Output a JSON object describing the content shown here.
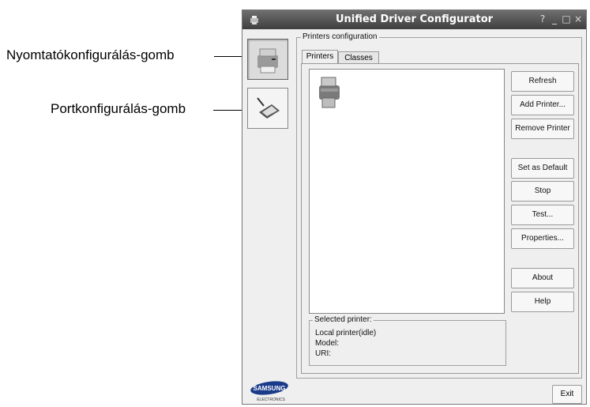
{
  "callouts": {
    "printer_config": "Nyomtatókonfigurálás-gomb",
    "port_config": "Portkonfigurálás-gomb"
  },
  "window": {
    "title": "Unified Driver Configurator",
    "controls": {
      "help": "?",
      "minimize": "_",
      "maximize": "□",
      "close": "×"
    }
  },
  "sidebar": {
    "items": [
      {
        "name": "printers-config",
        "icon": "printer-icon",
        "active": true
      },
      {
        "name": "ports-config",
        "icon": "port-icon",
        "active": false
      }
    ]
  },
  "printers_group": {
    "label": "Printers configuration"
  },
  "tabs": [
    {
      "label": "Printers",
      "active": true
    },
    {
      "label": "Classes",
      "active": false
    }
  ],
  "buttons": {
    "refresh": "Refresh",
    "add_printer": "Add Printer...",
    "remove_printer": "Remove Printer",
    "set_default": "Set as Default",
    "stop": "Stop",
    "test": "Test...",
    "properties": "Properties...",
    "about": "About",
    "help": "Help",
    "exit": "Exit"
  },
  "selected_printer": {
    "label": "Selected printer:",
    "line1": "Local printer(idle)",
    "line2": "Model:",
    "line3": "URI:"
  },
  "logo": {
    "brand": "SAMSUNG",
    "sub": "ELECTRONICS",
    "color": "#1a3a8a"
  }
}
